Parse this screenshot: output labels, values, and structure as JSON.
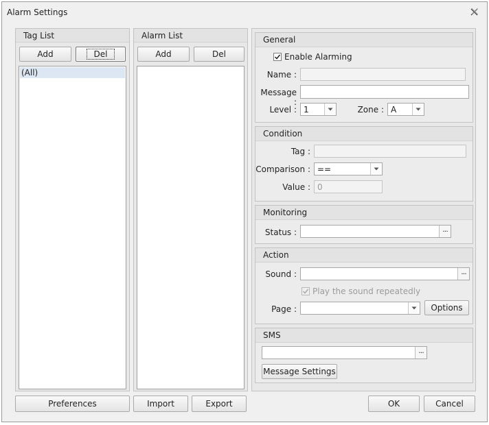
{
  "window": {
    "title": "Alarm Settings"
  },
  "tag_list": {
    "title": "Tag List",
    "add_label": "Add",
    "del_label": "Del",
    "items": [
      "(All)"
    ]
  },
  "alarm_list": {
    "title": "Alarm List",
    "add_label": "Add",
    "del_label": "Del",
    "items": []
  },
  "general": {
    "title": "General",
    "enable_label": "Enable Alarming",
    "enable_checked": true,
    "name_label": "Name :",
    "name_value": "",
    "message_label": "Message :",
    "message_value": "",
    "level_label": "Level :",
    "level_value": "1",
    "zone_label": "Zone :",
    "zone_value": "A"
  },
  "condition": {
    "title": "Condition",
    "tag_label": "Tag :",
    "tag_value": "",
    "comparison_label": "Comparison :",
    "comparison_value": "==",
    "value_label": "Value :",
    "value_value": "0"
  },
  "monitoring": {
    "title": "Monitoring",
    "status_label": "Status :",
    "status_value": ""
  },
  "action": {
    "title": "Action",
    "sound_label": "Sound :",
    "sound_value": "",
    "repeat_label": "Play the sound repeatedly",
    "repeat_checked": true,
    "page_label": "Page :",
    "page_value": "",
    "options_label": "Options"
  },
  "sms": {
    "title": "SMS",
    "value": "",
    "settings_label": "Message Settings"
  },
  "footer": {
    "preferences_label": "Preferences",
    "import_label": "Import",
    "export_label": "Export",
    "ok_label": "OK",
    "cancel_label": "Cancel"
  },
  "icons": {
    "close": "close-icon",
    "dropdown": "chevron-down-icon",
    "browse": "ellipsis-icon",
    "check": "check-icon"
  }
}
